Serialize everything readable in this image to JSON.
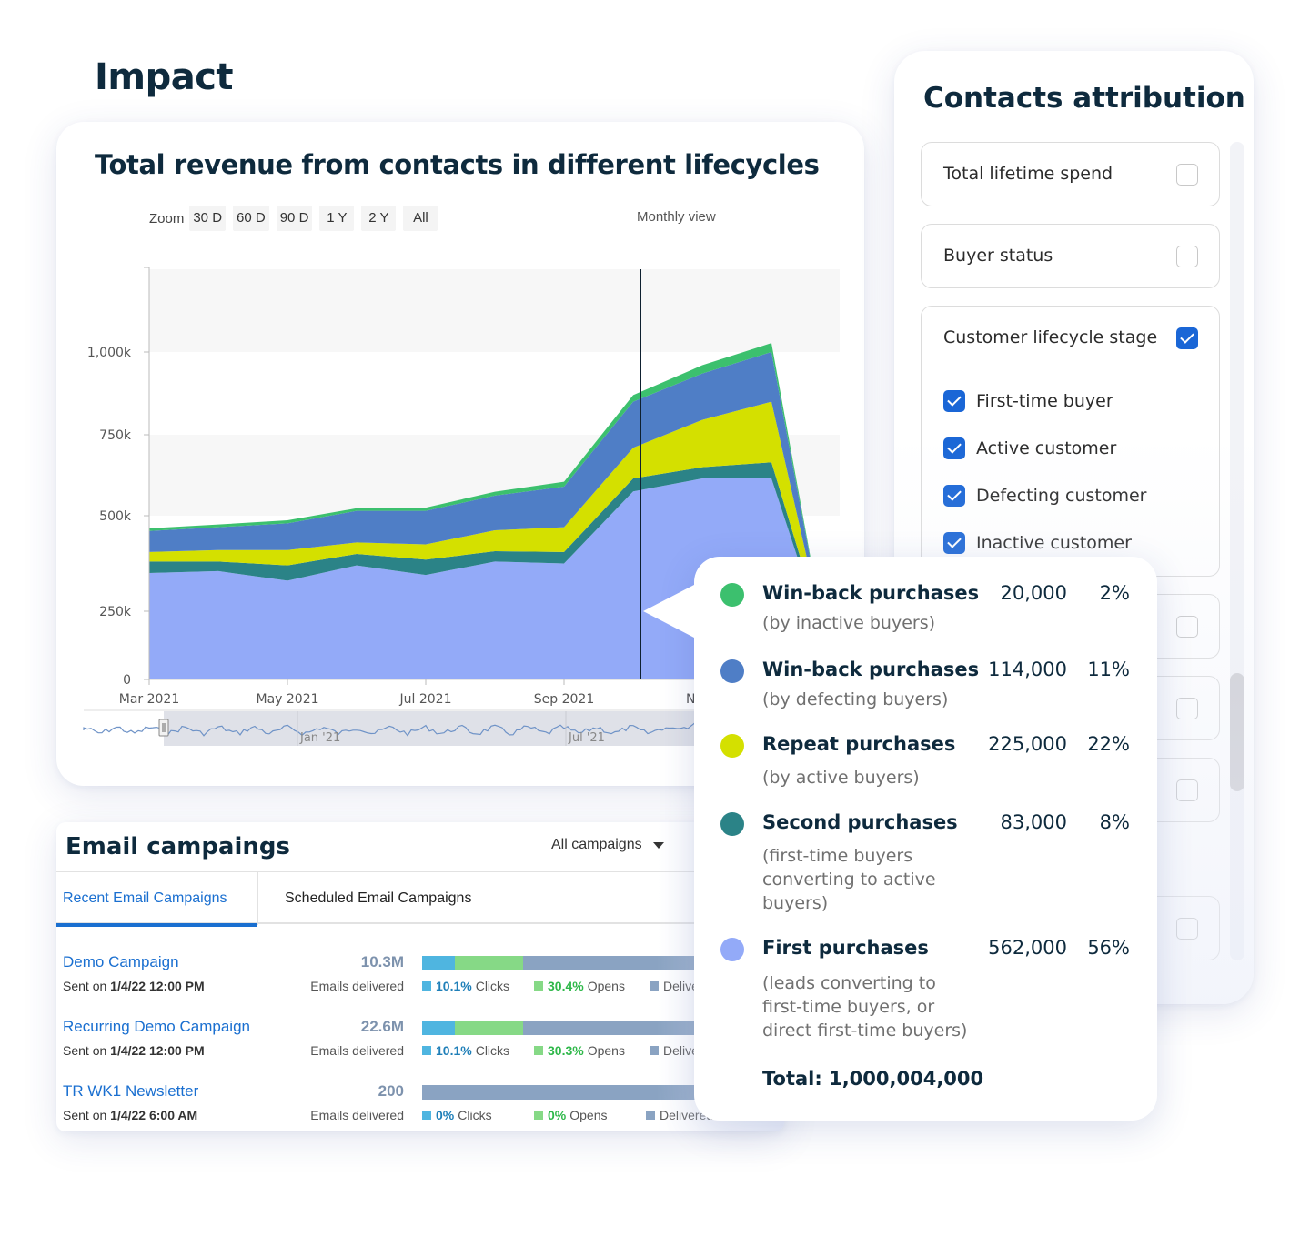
{
  "page": {
    "title": "Impact"
  },
  "chart_card": {
    "title": "Total revenue from contacts in different lifecycles",
    "zoom_label": "Zoom",
    "zoom_options": [
      "30 D",
      "60 D",
      "90 D",
      "1 Y",
      "2 Y",
      "All"
    ],
    "view_label": "Monthly view",
    "navigator_labels": [
      "Jan '21",
      "Jul '21"
    ]
  },
  "chart_data": {
    "type": "area",
    "stacked": true,
    "title": "Total revenue from contacts in different lifecycles",
    "xlabel": "",
    "ylabel": "",
    "x": [
      "Mar 2021",
      "Apr 2021",
      "May 2021",
      "Jun 2021",
      "Jul 2021",
      "Aug 2021",
      "Sep 2021",
      "Oct 2021",
      "Nov 2021",
      "Dec 2021",
      "Jan 2022"
    ],
    "x_tick_labels": [
      "Mar 2021",
      "May 2021",
      "Jul 2021",
      "Sep 2021",
      "Nov"
    ],
    "y_ticks": [
      0,
      250000,
      500000,
      750000,
      1000000
    ],
    "y_tick_labels": [
      "0",
      "250k",
      "500k",
      "750k",
      "1,000k"
    ],
    "ylim": [
      0,
      1250000
    ],
    "grid": true,
    "crosshair_x": "Oct 2021",
    "series": [
      {
        "name": "First purchases",
        "color": "#93aaf8",
        "values": [
          350000,
          355000,
          330000,
          370000,
          345000,
          380000,
          375000,
          575000,
          615000,
          615000,
          160000
        ]
      },
      {
        "name": "Second purchases",
        "color": "#2b8387",
        "values": [
          30000,
          25000,
          40000,
          30000,
          40000,
          27000,
          30000,
          40000,
          35000,
          50000,
          10000
        ]
      },
      {
        "name": "Repeat purchases",
        "color": "#d4e000",
        "values": [
          25000,
          30000,
          40000,
          30000,
          40000,
          55000,
          65000,
          95000,
          145000,
          185000,
          10000
        ]
      },
      {
        "name": "Win-back purchases (by defecting buyers)",
        "color": "#4f7ec6",
        "values": [
          55000,
          60000,
          70000,
          85000,
          90000,
          100000,
          120000,
          140000,
          140000,
          150000,
          8000
        ]
      },
      {
        "name": "Win-back purchases (by inactive buyers)",
        "color": "#3cc06e",
        "values": [
          7000,
          7000,
          8000,
          8000,
          10000,
          12000,
          15000,
          20000,
          25000,
          27000,
          2000
        ]
      }
    ]
  },
  "tooltip": {
    "items": [
      {
        "name": "Win-back purchases",
        "desc": "(by inactive buyers)",
        "value": "20,000",
        "pct": "2%",
        "color": "#3cc06e"
      },
      {
        "name": "Win-back purchases",
        "desc": "(by defecting buyers)",
        "value": "114,000",
        "pct": "11%",
        "color": "#4f7ec6"
      },
      {
        "name": "Repeat purchases",
        "desc": "(by active buyers)",
        "value": "225,000",
        "pct": "22%",
        "color": "#d4e000"
      },
      {
        "name": "Second purchases",
        "desc": "(first-time buyers\nconverting to active\nbuyers)",
        "value": "83,000",
        "pct": "8%",
        "color": "#2b8387"
      },
      {
        "name": "First purchases",
        "desc": "(leads converting to\nfirst-time buyers, or\ndirect first-time buyers)",
        "value": "562,000",
        "pct": "56%",
        "color": "#93aaf8"
      }
    ],
    "total": "Total: 1,000,004,000"
  },
  "contacts": {
    "title": "Contacts attribution",
    "options": [
      {
        "label": "Total lifetime spend",
        "checked": false
      },
      {
        "label": "Buyer status",
        "checked": false
      },
      {
        "label": "Customer lifecycle stage",
        "checked": true
      }
    ],
    "lifecycle_sub": [
      {
        "label": "First-time buyer",
        "checked": true
      },
      {
        "label": "Active customer",
        "checked": true
      },
      {
        "label": "Defecting customer",
        "checked": true
      },
      {
        "label": "Inactive customer",
        "checked": true
      }
    ],
    "hidden_options": [
      {
        "checked": false
      },
      {
        "checked": false
      },
      {
        "checked": false
      },
      {
        "checked": false
      }
    ]
  },
  "email": {
    "title": "Email campaings",
    "filter": "All campaigns",
    "tabs": [
      "Recent Email Campaigns",
      "Scheduled Email Campaigns"
    ],
    "delivered_label": "Emails delivered",
    "clicks_label": "Clicks",
    "opens_label": "Opens",
    "delivered_legend": "Delivered",
    "sent_prefix": "Sent on",
    "colors": {
      "clicks": "#4fb5e0",
      "opens": "#86d986",
      "delivered": "#8aa3c2",
      "clicks_text": "#1f7fb8",
      "opens_text": "#2fb84a"
    },
    "campaigns": [
      {
        "name": "Demo Campaign",
        "sent": "1/4/22 12:00 PM",
        "count": "10.3M",
        "clicks_pct": "10.1%",
        "opens_pct": "30.4%",
        "clicks_frac": 0.101,
        "opens_frac": 0.304
      },
      {
        "name": "Recurring Demo Campaign",
        "sent": "1/4/22 12:00 PM",
        "count": "22.6M",
        "clicks_pct": "10.1%",
        "opens_pct": "30.3%",
        "clicks_frac": 0.101,
        "opens_frac": 0.303
      },
      {
        "name": "TR WK1 Newsletter",
        "sent": "1/4/22 6:00 AM",
        "count": "200",
        "clicks_pct": "0%",
        "opens_pct": "0%",
        "clicks_frac": 0,
        "opens_frac": 0
      }
    ]
  }
}
